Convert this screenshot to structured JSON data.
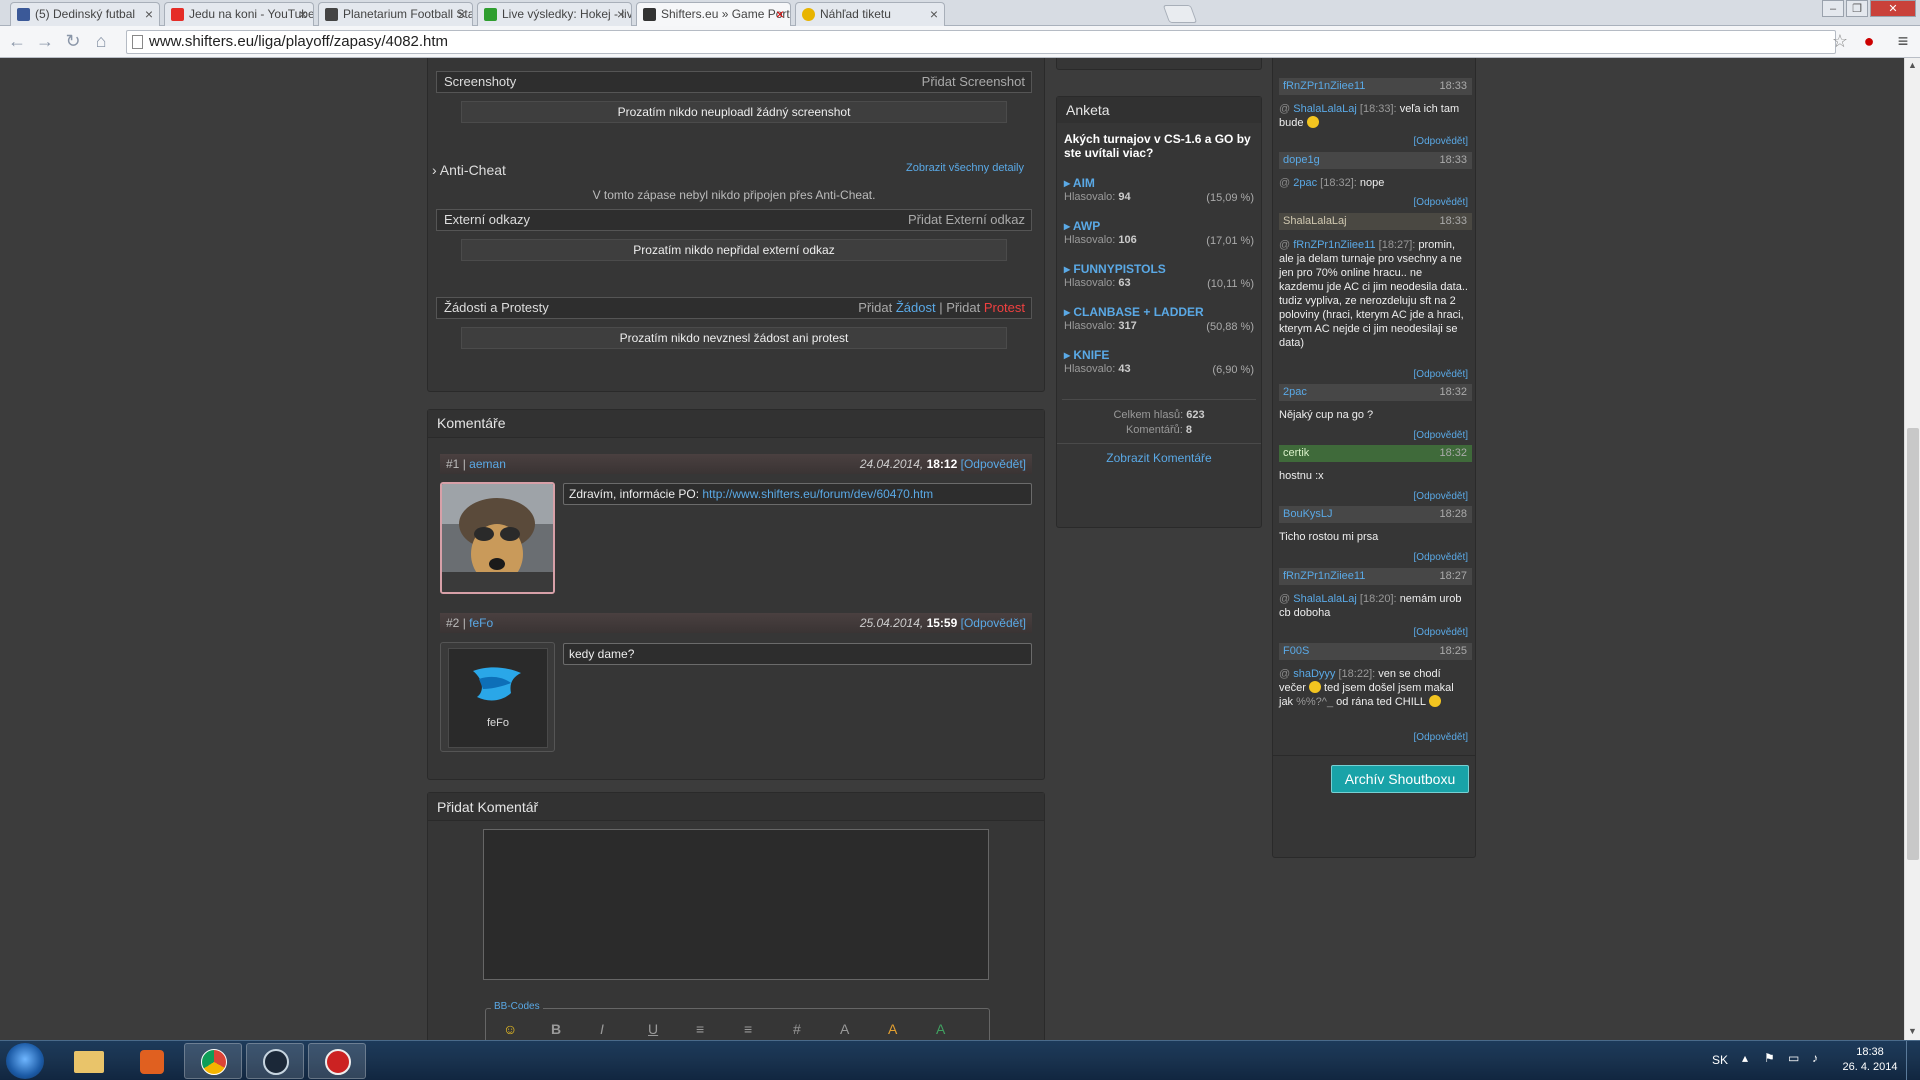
{
  "browser": {
    "tabs": [
      {
        "title": "(5) Dedinský futbal",
        "favicon_color": "#3b5998"
      },
      {
        "title": "Jedu na koni - YouTube",
        "favicon_color": "#e52d27"
      },
      {
        "title": "Planetarium Football Star",
        "favicon_color": "#444444"
      },
      {
        "title": "Live výsledky: Hokej - live",
        "favicon_color": "#2f9e2f"
      },
      {
        "title": "Shifters.eu » Game Portál",
        "favicon_color": "#333333"
      },
      {
        "title": "Náhľad tiketu",
        "favicon_color": "#e8b400"
      }
    ],
    "url": "www.shifters.eu/liga/playoff/zapasy/4082.htm"
  },
  "match": {
    "screenshots": {
      "title": "Screenshoty",
      "action": "Přidat Screenshot",
      "notice": "Prozatím nikdo neuploadl žádný screenshot"
    },
    "anticheat": {
      "title": "Anti-Cheat",
      "link": "Zobrazit všechny detaily",
      "notice": "V tomto zápase nebyl nikdo připojen přes Anti-Cheat."
    },
    "links": {
      "title": "Externí odkazy",
      "action": "Přidat Externí odkaz",
      "notice": "Prozatím nikdo nepřidal externí odkaz"
    },
    "requests": {
      "title": "Žádosti a Protesty",
      "add1": "Přidat",
      "req": "Žádost",
      "sep": "|",
      "add2": "Přidat",
      "protest": "Protest",
      "notice": "Prozatím nikdo nevznesl žádost ani protest"
    }
  },
  "comments": {
    "title": "Komentáře",
    "items": [
      {
        "num": "#1",
        "sep": "|",
        "author": "aeman",
        "date": "24.04.2014,",
        "time": "18:12",
        "reply": "[Odpovědět]",
        "text": "Zdravím, informácie PO:",
        "link": "http://www.shifters.eu/forum/dev/60470.htm"
      },
      {
        "num": "#2",
        "sep": "|",
        "author": "feFo",
        "date": "25.04.2014,",
        "time": "15:59",
        "reply": "[Odpovědět]",
        "text": "kedy dame?",
        "avatar_label": "feFo"
      }
    ]
  },
  "add_comment": {
    "title": "Přidat Komentář",
    "bbcodes": "BB-Codes"
  },
  "poll": {
    "title": "Anketa",
    "question": "Akých turnajov v CS-1.6 a GO by ste uvítali viac?",
    "votes_label": "Hlasovalo:",
    "options": [
      {
        "name": "AIM",
        "votes": "94",
        "pct": "(15,09 %)"
      },
      {
        "name": "AWP",
        "votes": "106",
        "pct": "(17,01 %)"
      },
      {
        "name": "FUNNYPISTOLS",
        "votes": "63",
        "pct": "(10,11 %)"
      },
      {
        "name": "CLANBASE + LADDER",
        "votes": "317",
        "pct": "(50,88 %)"
      },
      {
        "name": "KNIFE",
        "votes": "43",
        "pct": "(6,90 %)"
      }
    ],
    "total_label": "Celkem hlasů:",
    "total": "623",
    "comments_label": "Komentářů:",
    "comments": "8",
    "show_comments": "Zobrazit Komentáře"
  },
  "shoutbox": {
    "reply_label": "[Odpovědět]",
    "entries": [
      {
        "user": "fRnZPr1nZiiee11",
        "time": "18:33",
        "mention": "ShalaLalaLaj",
        "mention_time": "[18:33]:",
        "text": "veľa ich tam bude"
      },
      {
        "user": "dope1g",
        "time": "18:33",
        "mention": "2pac",
        "mention_time": "[18:32]:",
        "text": "nope"
      },
      {
        "user": "ShalaLalaLaj",
        "time": "18:33",
        "mention": "fRnZPr1nZiiee11",
        "mention_time": "[18:27]:",
        "text": "promin, ale ja delam turnaje pro vsechny a ne jen pro 70% online hracu.. ne kazdemu jde AC ci jim neodesila data.. tudiz vypliva, ze nerozdeluju sft na 2 poloviny (hraci, kterym AC jde a hraci, kterym AC nejde ci jim neodesilaji se data)"
      },
      {
        "user": "2pac",
        "time": "18:32",
        "text": "Nějaký cup na go ?"
      },
      {
        "user": "certik",
        "time": "18:32",
        "text": "hostnu :x"
      },
      {
        "user": "BouKysLJ",
        "time": "18:28",
        "text": "Ticho rostou mi prsa"
      },
      {
        "user": "fRnZPr1nZiiee11",
        "time": "18:27",
        "mention": "ShalaLalaLaj",
        "mention_time": "[18:20]:",
        "text": "nemám urob cb doboha"
      },
      {
        "user": "F00S",
        "time": "18:25",
        "mention": "shaDyyy",
        "mention_time": "[18:22]:",
        "text1": "ven se chodí večer",
        "text2": "ted jsem došel jsem makal jak",
        "text3": "%%?^_",
        "text4": "od rána ted CHILL"
      }
    ],
    "archive_button": "Archív Shoutboxu"
  },
  "taskbar": {
    "lang": "SK",
    "time": "18:38",
    "date": "26. 4. 2014"
  },
  "colors": {
    "link_blue": "#5aa9e6",
    "protest_red": "#f04040",
    "archive_teal": "#19a3a8",
    "page_bg": "#3c3c3c"
  }
}
